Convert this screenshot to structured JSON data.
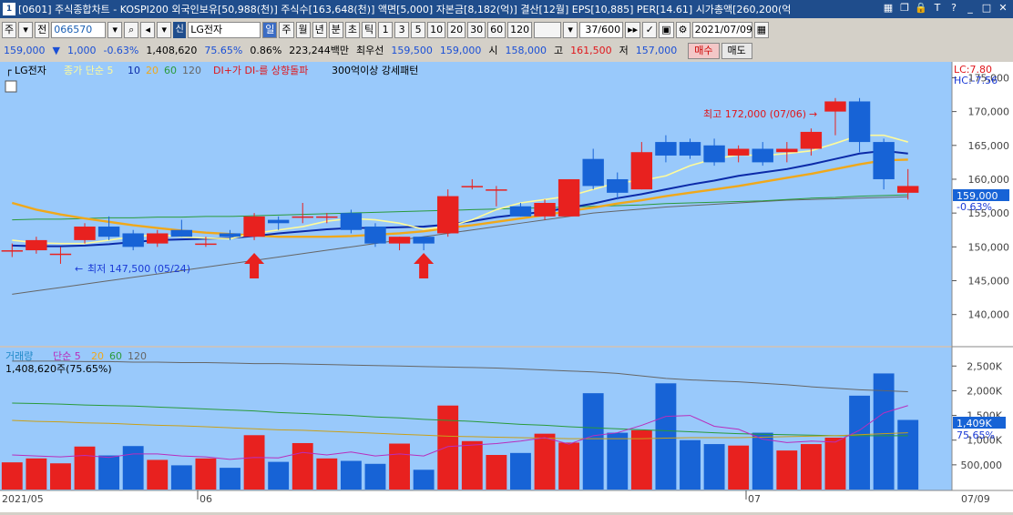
{
  "titlebar": {
    "title": "[0601] 주식종합차트 - KOSPI200 외국인보유[50,988(천)] 주식수[163,648(천)] 액면[5,000] 자본금[8,182(억)] 결산[12월] EPS[10,885] PER[14.61] 시가총액[260,200(억"
  },
  "toolbar1": {
    "period_label": "주",
    "type_label": "전",
    "code": "066570",
    "sin": "신",
    "name": "LG전자",
    "periods": [
      "일",
      "주",
      "월",
      "년",
      "분",
      "초",
      "틱"
    ],
    "intervals": [
      "1",
      "3",
      "5",
      "10",
      "20",
      "30",
      "60",
      "120"
    ],
    "count": "37/600",
    "date": "2021/07/09"
  },
  "toolbar2": {
    "price": "159,000",
    "change": "1,000",
    "change_pct": "-0.63%",
    "volume": "1,408,620",
    "vol_ratio": "75.65%",
    "turnover_pct": "0.86%",
    "amount": "223,244백만",
    "quote_label": "최우선",
    "ask": "159,500",
    "bid": "159,000",
    "open_label": "시",
    "open": "158,000",
    "high_label": "고",
    "high": "161,500",
    "low_label": "저",
    "low": "157,000",
    "buy_label": "매수",
    "sell_label": "매도"
  },
  "legend": {
    "stock": "LG전자",
    "ma_label": "종가 단순 5",
    "ma10": "10",
    "ma20": "20",
    "ma60": "60",
    "ma120": "120",
    "signal": "DI+가 DI-를 상향돌파",
    "pattern": "300억이상 강세패턴"
  },
  "volume_legend": {
    "label": "거래량",
    "ma_label": "단순 5",
    "ma20": "20",
    "ma60": "60",
    "ma120": "120",
    "value": "1,408,620주(75.65%)"
  },
  "annotations": {
    "high_note": "최고 172,000 (07/06)",
    "low_note": "최저 147,500 (05/24)",
    "lc": "LC:7.80",
    "hc": "HC:-7.56",
    "price_tag": "159,000",
    "pct_tag": "-0.63%",
    "vol_tag": "1,409K",
    "vol_pct_tag": "75.65%"
  },
  "price_axis": [
    "175,000",
    "170,000",
    "165,000",
    "160,000",
    "155,000",
    "150,000",
    "145,000",
    "140,000"
  ],
  "volume_axis": [
    "2,500K",
    "2,000K",
    "1,500K",
    "1,000K",
    "500,000"
  ],
  "date_axis": [
    "2021/05",
    "06",
    "07",
    "07/09"
  ],
  "colors": {
    "up": "#e8211f",
    "down": "#1763d6",
    "bg": "#99c9fb",
    "ma5": "#fffb9a",
    "ma10": "#0b2aa8",
    "ma20": "#f0a81a",
    "ma60": "#2a9a3a",
    "ma120": "#666666"
  },
  "chart_data": {
    "type": "candlestick",
    "price_range": [
      137000,
      176000
    ],
    "volume_range": [
      0,
      2800000
    ],
    "candles": [
      {
        "o": 149500,
        "h": 150500,
        "l": 148500,
        "c": 149500,
        "v": 550000
      },
      {
        "o": 149500,
        "h": 151500,
        "l": 149000,
        "c": 151000,
        "v": 630000
      },
      {
        "o": 149000,
        "h": 150000,
        "l": 147500,
        "c": 149000,
        "v": 530000
      },
      {
        "o": 151000,
        "h": 153500,
        "l": 150500,
        "c": 153000,
        "v": 870000
      },
      {
        "o": 153000,
        "h": 154500,
        "l": 151000,
        "c": 151500,
        "v": 690000
      },
      {
        "o": 152000,
        "h": 152500,
        "l": 149500,
        "c": 150000,
        "v": 880000
      },
      {
        "o": 150500,
        "h": 152500,
        "l": 150000,
        "c": 152000,
        "v": 600000
      },
      {
        "o": 152500,
        "h": 154000,
        "l": 151500,
        "c": 151500,
        "v": 490000
      },
      {
        "o": 150500,
        "h": 151500,
        "l": 150000,
        "c": 150500,
        "v": 630000
      },
      {
        "o": 152000,
        "h": 152500,
        "l": 151000,
        "c": 151500,
        "v": 440000
      },
      {
        "o": 151500,
        "h": 155000,
        "l": 151000,
        "c": 154500,
        "v": 1100000
      },
      {
        "o": 154000,
        "h": 154500,
        "l": 152500,
        "c": 153500,
        "v": 560000
      },
      {
        "o": 154500,
        "h": 156500,
        "l": 153500,
        "c": 154500,
        "v": 940000
      },
      {
        "o": 154500,
        "h": 155000,
        "l": 153500,
        "c": 154500,
        "v": 630000
      },
      {
        "o": 155000,
        "h": 155500,
        "l": 152000,
        "c": 152500,
        "v": 580000
      },
      {
        "o": 153000,
        "h": 153500,
        "l": 150000,
        "c": 150500,
        "v": 520000
      },
      {
        "o": 150500,
        "h": 151500,
        "l": 149500,
        "c": 151500,
        "v": 930000
      },
      {
        "o": 151500,
        "h": 151500,
        "l": 149500,
        "c": 150500,
        "v": 400000
      },
      {
        "o": 152000,
        "h": 158500,
        "l": 151500,
        "c": 157500,
        "v": 1700000
      },
      {
        "o": 159000,
        "h": 160000,
        "l": 158500,
        "c": 159000,
        "v": 980000
      },
      {
        "o": 158500,
        "h": 159000,
        "l": 156000,
        "c": 158500,
        "v": 700000
      },
      {
        "o": 156000,
        "h": 156500,
        "l": 154500,
        "c": 154500,
        "v": 740000
      },
      {
        "o": 154500,
        "h": 157000,
        "l": 154000,
        "c": 156500,
        "v": 1130000
      },
      {
        "o": 154500,
        "h": 160000,
        "l": 154500,
        "c": 160000,
        "v": 950000
      },
      {
        "o": 163000,
        "h": 164500,
        "l": 158500,
        "c": 159000,
        "v": 1950000
      },
      {
        "o": 160000,
        "h": 161000,
        "l": 157000,
        "c": 158000,
        "v": 1150000
      },
      {
        "o": 158500,
        "h": 165500,
        "l": 158500,
        "c": 164000,
        "v": 1200000
      },
      {
        "o": 165500,
        "h": 166500,
        "l": 162500,
        "c": 163500,
        "v": 2150000
      },
      {
        "o": 165500,
        "h": 166000,
        "l": 163000,
        "c": 163500,
        "v": 1000000
      },
      {
        "o": 165000,
        "h": 166000,
        "l": 162000,
        "c": 162500,
        "v": 920000
      },
      {
        "o": 163500,
        "h": 165000,
        "l": 162500,
        "c": 164500,
        "v": 890000
      },
      {
        "o": 164500,
        "h": 165500,
        "l": 162000,
        "c": 162500,
        "v": 1150000
      },
      {
        "o": 164000,
        "h": 165500,
        "l": 162500,
        "c": 164500,
        "v": 790000
      },
      {
        "o": 164500,
        "h": 167500,
        "l": 163500,
        "c": 167000,
        "v": 920000
      },
      {
        "o": 170000,
        "h": 172000,
        "l": 166500,
        "c": 171500,
        "v": 1050000
      },
      {
        "o": 171500,
        "h": 172000,
        "l": 164000,
        "c": 165500,
        "v": 1900000
      },
      {
        "o": 165500,
        "h": 166000,
        "l": 158500,
        "c": 160000,
        "v": 2350000
      },
      {
        "o": 158000,
        "h": 161500,
        "l": 157000,
        "c": 159000,
        "v": 1409000
      }
    ],
    "ma5": [
      151000,
      150600,
      150500,
      150500,
      151000,
      151500,
      151800,
      151500,
      151300,
      151200,
      152000,
      152500,
      153000,
      153800,
      154200,
      154000,
      153500,
      152600,
      153000,
      154000,
      155500,
      156500,
      157000,
      157500,
      158500,
      159500,
      159800,
      160500,
      162000,
      163000,
      163600,
      163500,
      163800,
      164200,
      165300,
      166500,
      166500,
      165500
    ],
    "ma10": [
      150200,
      150100,
      150100,
      150200,
      150400,
      150700,
      151000,
      151100,
      151200,
      151300,
      151600,
      152000,
      152300,
      152600,
      152800,
      152800,
      152900,
      153000,
      153300,
      153800,
      154400,
      154800,
      155200,
      155800,
      156400,
      157200,
      157800,
      158500,
      159200,
      159800,
      160500,
      161000,
      161500,
      162200,
      163000,
      163800,
      164200,
      163800
    ],
    "ma20": [
      156500,
      155500,
      154800,
      154200,
      153700,
      153200,
      152800,
      152400,
      152100,
      151900,
      151700,
      151500,
      151500,
      151500,
      151600,
      151800,
      152000,
      152300,
      152800,
      153200,
      153700,
      154200,
      154700,
      155300,
      155800,
      156400,
      156900,
      157500,
      158000,
      158500,
      159000,
      159600,
      160200,
      160800,
      161500,
      162200,
      162800,
      162900
    ],
    "ma60": [
      154000,
      154100,
      154100,
      154200,
      154300,
      154300,
      154400,
      154400,
      154500,
      154500,
      154600,
      154700,
      154800,
      154900,
      155000,
      155100,
      155200,
      155300,
      155400,
      155500,
      155600,
      155700,
      155800,
      155900,
      156000,
      156100,
      156200,
      156400,
      156500,
      156600,
      156700,
      156800,
      157000,
      157200,
      157300,
      157500,
      157600,
      157700
    ],
    "ma120": [
      143000,
      143500,
      144000,
      144500,
      145000,
      145500,
      146000,
      146500,
      147000,
      147500,
      148000,
      148500,
      149000,
      149500,
      150000,
      150500,
      151000,
      151500,
      152000,
      152500,
      153000,
      153500,
      154000,
      154500,
      155000,
      155300,
      155600,
      155900,
      156100,
      156300,
      156500,
      156700,
      156900,
      157000,
      157100,
      157200,
      157300,
      157400
    ],
    "vol_ma5": [
      700000,
      680000,
      660000,
      690000,
      650000,
      720000,
      720000,
      680000,
      660000,
      610000,
      650000,
      640000,
      750000,
      700000,
      760000,
      680000,
      720000,
      680000,
      870000,
      900000,
      930000,
      980000,
      1050000,
      920000,
      1090000,
      1150000,
      1300000,
      1480000,
      1500000,
      1280000,
      1220000,
      1020000,
      950000,
      980000,
      960000,
      1200000,
      1550000,
      1700000
    ],
    "vol_ma20": [
      1400000,
      1380000,
      1370000,
      1350000,
      1340000,
      1320000,
      1300000,
      1290000,
      1270000,
      1250000,
      1230000,
      1210000,
      1200000,
      1180000,
      1160000,
      1140000,
      1120000,
      1100000,
      1080000,
      1070000,
      1060000,
      1050000,
      1040000,
      1030000,
      1030000,
      1030000,
      1030000,
      1040000,
      1050000,
      1050000,
      1050000,
      1060000,
      1070000,
      1080000,
      1090000,
      1110000,
      1130000,
      1150000
    ],
    "vol_ma60": [
      1750000,
      1740000,
      1730000,
      1710000,
      1700000,
      1690000,
      1670000,
      1650000,
      1630000,
      1610000,
      1590000,
      1560000,
      1540000,
      1520000,
      1500000,
      1470000,
      1450000,
      1420000,
      1400000,
      1380000,
      1350000,
      1320000,
      1300000,
      1270000,
      1250000,
      1230000,
      1210000,
      1190000,
      1170000,
      1150000,
      1130000,
      1120000,
      1110000,
      1100000,
      1090000,
      1090000,
      1090000,
      1090000
    ],
    "vol_ma120": [
      2600000,
      2600000,
      2600000,
      2590000,
      2590000,
      2580000,
      2580000,
      2570000,
      2570000,
      2560000,
      2550000,
      2550000,
      2540000,
      2530000,
      2520000,
      2510000,
      2500000,
      2490000,
      2480000,
      2470000,
      2460000,
      2440000,
      2420000,
      2400000,
      2380000,
      2350000,
      2300000,
      2250000,
      2220000,
      2200000,
      2180000,
      2150000,
      2120000,
      2080000,
      2050000,
      2020000,
      2000000,
      1980000
    ],
    "arrows_at": [
      10,
      17
    ]
  }
}
